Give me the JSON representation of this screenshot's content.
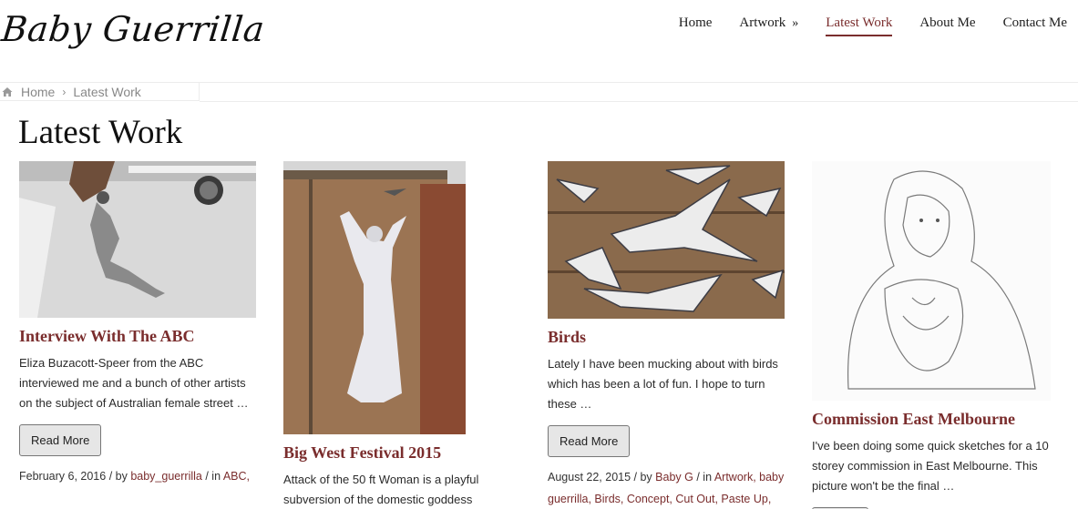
{
  "site": {
    "logo_text": "Baby Guerrilla"
  },
  "nav": {
    "items": [
      {
        "label": "Home"
      },
      {
        "label": "Artwork",
        "chevron": "»"
      },
      {
        "label": "Latest Work"
      },
      {
        "label": "About Me"
      },
      {
        "label": "Contact Me"
      }
    ],
    "active_index": 2
  },
  "breadcrumb": {
    "home": "Home",
    "separator": "›",
    "current": "Latest Work"
  },
  "page_title": "Latest Work",
  "accent_color": "#7a2d2d",
  "posts": [
    {
      "title": "Interview With The ABC",
      "excerpt": "Eliza Buzacott-Speer from the ABC interviewed me and a bunch of other artists on the subject of Australian female street …",
      "button": "Read More",
      "date": "February 6, 2016",
      "by": "/ by",
      "author": "baby_guerrilla",
      "in": "/ in",
      "tags": [
        "ABC,"
      ]
    },
    {
      "title": "Big West Festival 2015",
      "excerpt": "Attack of the 50 ft Woman is a playful subversion of the domestic goddess"
    },
    {
      "title": "Birds",
      "excerpt": "Lately I have been mucking about with birds which has been a lot of fun. I hope to turn these …",
      "button": "Read More",
      "date": "August 22, 2015",
      "by": "/ by",
      "author": "Baby G",
      "in": "/ in",
      "tags": [
        "Artwork,",
        "baby guerrilla,",
        "Birds,",
        "Concept,",
        "Cut Out,",
        "Paste Up,"
      ]
    },
    {
      "title": "Commission East Melbourne",
      "excerpt": "I've been doing some quick sketches for a 10 storey commission in East Melbourne.  This picture won't be the final …"
    }
  ]
}
